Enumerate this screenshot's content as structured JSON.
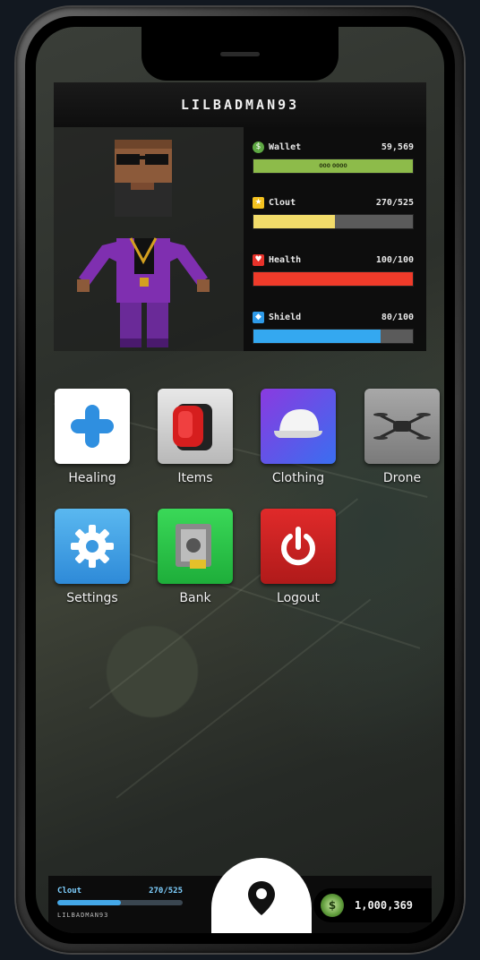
{
  "header": {
    "username": "LILBADMAN93"
  },
  "stats": {
    "wallet": {
      "label": "Wallet",
      "value": "59,569",
      "bar_text": "000 0000",
      "fill": 1.0,
      "color": "#8dbb4a",
      "icon": "cash-icon",
      "icon_color": "#5ea843"
    },
    "clout": {
      "label": "Clout",
      "value": "270/525",
      "fill": 0.51,
      "color": "#f2dc6a",
      "icon": "star-icon",
      "icon_color": "#f4c21f"
    },
    "health": {
      "label": "Health",
      "value": "100/100",
      "fill": 1.0,
      "color": "#ef3b2a",
      "icon": "heart-icon",
      "icon_color": "#e8322a"
    },
    "shield": {
      "label": "Shield",
      "value": "80/100",
      "fill": 0.8,
      "color": "#34a8f0",
      "icon": "shield-icon",
      "icon_color": "#2e9ae8"
    }
  },
  "apps": [
    {
      "label": "Healing",
      "icon": "medical-cross-icon"
    },
    {
      "label": "Items",
      "icon": "backpack-icon"
    },
    {
      "label": "Clothing",
      "icon": "cap-icon"
    },
    {
      "label": "Drone",
      "icon": "drone-icon"
    },
    {
      "label": "Settings",
      "icon": "gear-icon"
    },
    {
      "label": "Bank",
      "icon": "safe-icon"
    },
    {
      "label": "Logout",
      "icon": "power-icon"
    }
  ],
  "footer": {
    "clout_label": "Clout",
    "clout_value": "270/525",
    "clout_fill": 0.51,
    "username": "LILBADMAN93",
    "map_icon": "map-pin-icon",
    "cash_value": "1,000,369"
  }
}
